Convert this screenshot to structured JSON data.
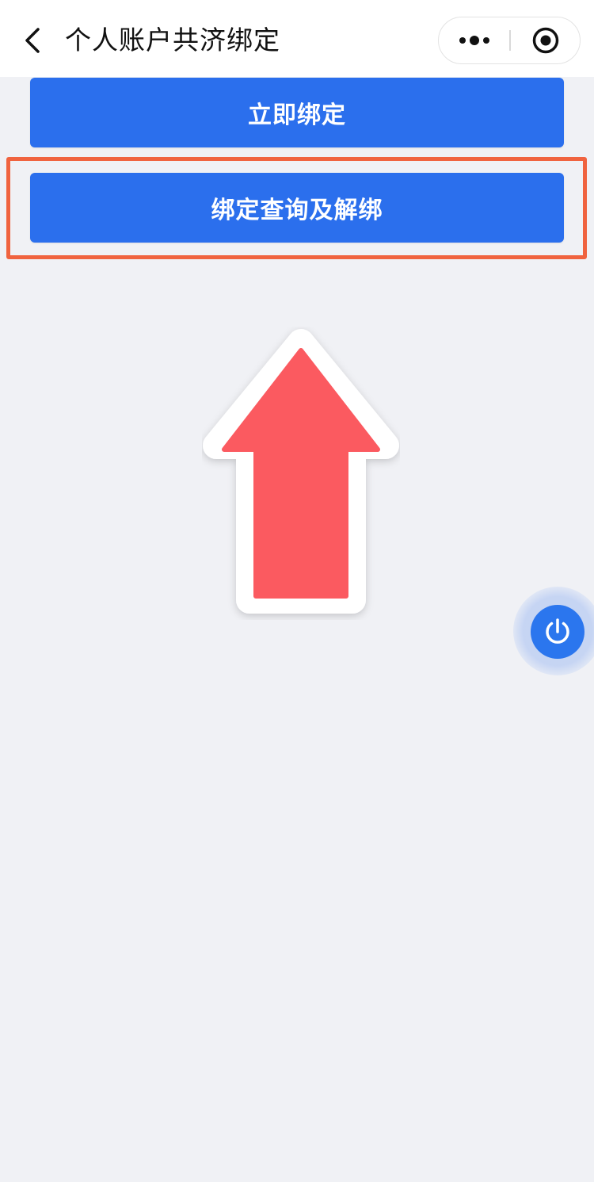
{
  "header": {
    "title": "个人账户共济绑定",
    "back_icon": "chevron-left-icon",
    "more_icon": "more-dots-icon",
    "close_icon": "target-close-icon"
  },
  "actions": {
    "bind_now_label": "立即绑定",
    "query_unbind_label": "绑定查询及解绑"
  },
  "annotation": {
    "highlight_color": "#f0633f",
    "arrow_color": "#fb5a60",
    "arrow_icon": "arrow-up-icon"
  },
  "float_button": {
    "icon": "power-icon",
    "color": "#2b76ee"
  },
  "colors": {
    "primary": "#2b6fed",
    "background": "#f0f1f5"
  }
}
